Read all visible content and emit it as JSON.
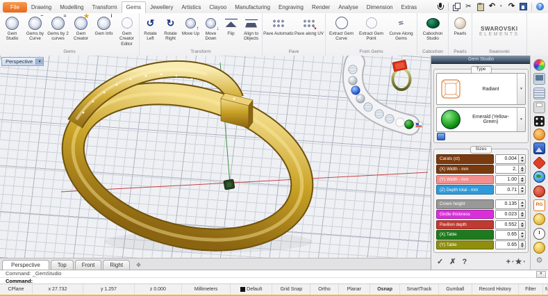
{
  "menu": {
    "tabs": [
      {
        "label": "File"
      },
      {
        "label": "Drawing"
      },
      {
        "label": "Modelling"
      },
      {
        "label": "Transform"
      },
      {
        "label": "Gems"
      },
      {
        "label": "Jewellery"
      },
      {
        "label": "Artistics"
      },
      {
        "label": "Clayoo"
      },
      {
        "label": "Manufacturing"
      },
      {
        "label": "Engraving"
      },
      {
        "label": "Render"
      },
      {
        "label": "Analyse"
      },
      {
        "label": "Dimension"
      },
      {
        "label": "Extras"
      }
    ]
  },
  "ribbon": {
    "groups": [
      {
        "caption": "Gems",
        "items": [
          "Gem Studio",
          "Gems by Curve",
          "Gems by 2 curves",
          "Gem Creator",
          "Gem Info",
          "Gem Creator Editor"
        ]
      },
      {
        "caption": "Transform",
        "items": [
          "Rotate Left",
          "Rotate Right",
          "Move Up",
          "Move Down",
          "Flip",
          "Align to Objects"
        ]
      },
      {
        "caption": "Pave",
        "items": [
          "Pave Automatic",
          "Pave along UV"
        ]
      },
      {
        "caption": "From Gems",
        "items": [
          "Extract Gem Curve",
          "Extract Gem Point",
          "Curve Along Gems"
        ]
      },
      {
        "caption": "Cabochon",
        "items": [
          "Cabochon Studio"
        ]
      },
      {
        "caption": "Pearls",
        "items": [
          "Pearls"
        ]
      },
      {
        "caption": "Swarovski",
        "logo1": "SWAROVSKI",
        "logo2": "ELEMENTS"
      }
    ]
  },
  "viewport": {
    "view_label": "Perspective"
  },
  "panel": {
    "title": "Gem Studio",
    "type_caption": "Type",
    "cut": "Radiant",
    "material": "Emerald (Yellow-Green)",
    "sizes_caption": "Sizes",
    "rows": [
      {
        "label": "Carats (ct)",
        "value": "0.004",
        "color": "#7a3a10"
      },
      {
        "label": "(X) Width - mm",
        "value": "2,",
        "color": "#7a3a10"
      },
      {
        "label": "(Y) Width - mm",
        "value": "1.00",
        "color": "#f48f8f"
      },
      {
        "label": "(Z) Depth total - mm",
        "value": "0.71",
        "color": "#2f9ada"
      },
      {
        "label": "Crown height",
        "value": "0.135",
        "color": "#989898"
      },
      {
        "label": "Girdle thickness",
        "value": "0.023",
        "color": "#d92fd9"
      },
      {
        "label": "Pavilion depth",
        "value": "0.552",
        "color": "#bf3a30"
      },
      {
        "label": "(X) Table",
        "value": "0.65",
        "color": "#1f7a1f"
      },
      {
        "label": "(Y) Table",
        "value": "0.65",
        "color": "#8f8f0f"
      }
    ]
  },
  "view_tabs": {
    "tabs": [
      {
        "label": "Perspective"
      },
      {
        "label": "Top"
      },
      {
        "label": "Front"
      },
      {
        "label": "Right"
      }
    ]
  },
  "command": {
    "history": "Command: _GemStudio",
    "prompt": "Command:"
  },
  "status": {
    "cells": [
      {
        "label": "CPlane"
      },
      {
        "label": "x 27.732"
      },
      {
        "label": "y 1.257"
      },
      {
        "label": "z 0.000"
      },
      {
        "label": "Millimeters"
      },
      {
        "label": "Default"
      }
    ],
    "toggles": [
      {
        "label": "Grid Snap"
      },
      {
        "label": "Ortho"
      },
      {
        "label": "Planar"
      },
      {
        "label": "Osnap"
      },
      {
        "label": "SmartTrack"
      },
      {
        "label": "Gumball"
      },
      {
        "label": "Record History"
      },
      {
        "label": "Filter"
      },
      {
        "label": "Minutes from last s..."
      }
    ]
  },
  "strip": {
    "rg_label": "RG"
  },
  "icons": {
    "dropdown": "▾",
    "check": "✓",
    "close": "✗",
    "help": "?",
    "add": "+",
    "star": "★",
    "new_viewport": "✥",
    "undo": "↶",
    "redo": "↷",
    "cut": "✂",
    "gear": "⚙",
    "scroll_up": "▲",
    "scroll_down": "▼"
  },
  "colors": {
    "accent_orange": "#e8681c",
    "gold": "#c9a227",
    "viewport_bg": "#eef0f4"
  }
}
